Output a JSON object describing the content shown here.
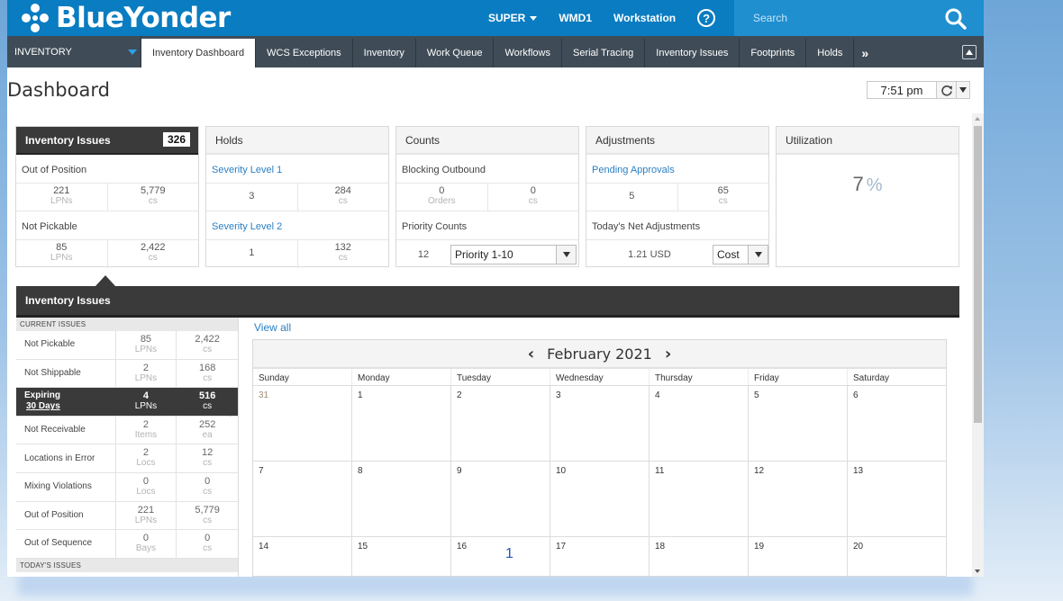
{
  "brand": {
    "name": "BlueYonder"
  },
  "topnav": {
    "user": "SUPER",
    "warehouse": "WMD1",
    "workstation": "Workstation",
    "help_glyph": "?"
  },
  "search": {
    "placeholder": "Search"
  },
  "module": {
    "label": "INVENTORY"
  },
  "tabs": [
    "Inventory Dashboard",
    "WCS Exceptions",
    "Inventory",
    "Work Queue",
    "Workflows",
    "Serial Tracing",
    "Inventory Issues",
    "Footprints",
    "Holds"
  ],
  "tab_more": "»",
  "page": {
    "title": "Dashboard",
    "time": "7:51 pm"
  },
  "cards": {
    "inventory_issues": {
      "title": "Inventory Issues",
      "badge": "326",
      "sec1": "Out of Position",
      "sec1_v1": "221",
      "sec1_u1": "LPNs",
      "sec1_v2": "5,779",
      "sec1_u2": "cs",
      "sec2": "Not Pickable",
      "sec2_v1": "85",
      "sec2_u1": "LPNs",
      "sec2_v2": "2,422",
      "sec2_u2": "cs"
    },
    "holds": {
      "title": "Holds",
      "sec1": "Severity Level 1",
      "sec1_v1": "3",
      "sec1_v2": "284",
      "sec1_u2": "cs",
      "sec2": "Severity Level 2",
      "sec2_v1": "1",
      "sec2_v2": "132",
      "sec2_u2": "cs"
    },
    "counts": {
      "title": "Counts",
      "sec1": "Blocking Outbound",
      "sec1_v1": "0",
      "sec1_u1": "Orders",
      "sec1_v2": "0",
      "sec1_u2": "cs",
      "sec2": "Priority Counts",
      "prio_value": "12",
      "prio_select": "Priority 1-10"
    },
    "adjustments": {
      "title": "Adjustments",
      "sec1": "Pending Approvals",
      "sec1_v1": "5",
      "sec1_v2": "65",
      "sec1_u2": "cs",
      "sec2": "Today's Net Adjustments",
      "net_value": "1.21 USD",
      "net_select": "Cost"
    },
    "utilization": {
      "title": "Utilization",
      "value": "7",
      "unit": "%"
    }
  },
  "issues_panel": {
    "title": "Inventory Issues",
    "current_header": "CURRENT ISSUES",
    "today_header": "TODAY'S ISSUES",
    "view_all": "View all",
    "rows": [
      {
        "label": "Not Pickable",
        "v1": "85",
        "u1": "LPNs",
        "v2": "2,422",
        "u2": "cs"
      },
      {
        "label": "Not Shippable",
        "v1": "2",
        "u1": "LPNs",
        "v2": "168",
        "u2": "cs"
      },
      {
        "label": "Expiring",
        "sub": "30 Days",
        "v1": "4",
        "u1": "LPNs",
        "v2": "516",
        "u2": "cs",
        "selected": true
      },
      {
        "label": "Not Receivable",
        "v1": "2",
        "u1": "Items",
        "v2": "252",
        "u2": "ea"
      },
      {
        "label": "Locations in Error",
        "v1": "2",
        "u1": "Locs",
        "v2": "12",
        "u2": "cs"
      },
      {
        "label": "Mixing Violations",
        "v1": "0",
        "u1": "Locs",
        "v2": "0",
        "u2": "cs"
      },
      {
        "label": "Out of Position",
        "v1": "221",
        "u1": "LPNs",
        "v2": "5,779",
        "u2": "cs"
      },
      {
        "label": "Out of Sequence",
        "v1": "0",
        "u1": "Bays",
        "v2": "0",
        "u2": "cs"
      }
    ]
  },
  "calendar": {
    "month": "February 2021",
    "prev_glyph": "‹",
    "next_glyph": "›",
    "days": [
      "Sunday",
      "Monday",
      "Tuesday",
      "Wednesday",
      "Thursday",
      "Friday",
      "Saturday"
    ],
    "weeks": [
      [
        {
          "d": "31",
          "other": true
        },
        {
          "d": "1"
        },
        {
          "d": "2"
        },
        {
          "d": "3"
        },
        {
          "d": "4"
        },
        {
          "d": "5"
        },
        {
          "d": "6"
        }
      ],
      [
        {
          "d": "7"
        },
        {
          "d": "8"
        },
        {
          "d": "9"
        },
        {
          "d": "10"
        },
        {
          "d": "11"
        },
        {
          "d": "12"
        },
        {
          "d": "13"
        }
      ],
      [
        {
          "d": "14"
        },
        {
          "d": "15"
        },
        {
          "d": "16",
          "count": "1"
        },
        {
          "d": "17"
        },
        {
          "d": "18"
        },
        {
          "d": "19"
        },
        {
          "d": "20"
        }
      ]
    ]
  },
  "colors": {
    "brand_blue": "#0a7cc1",
    "tabbar": "#3f4c57",
    "dark_panel": "#3a3a3a",
    "link": "#2a7fc4"
  }
}
